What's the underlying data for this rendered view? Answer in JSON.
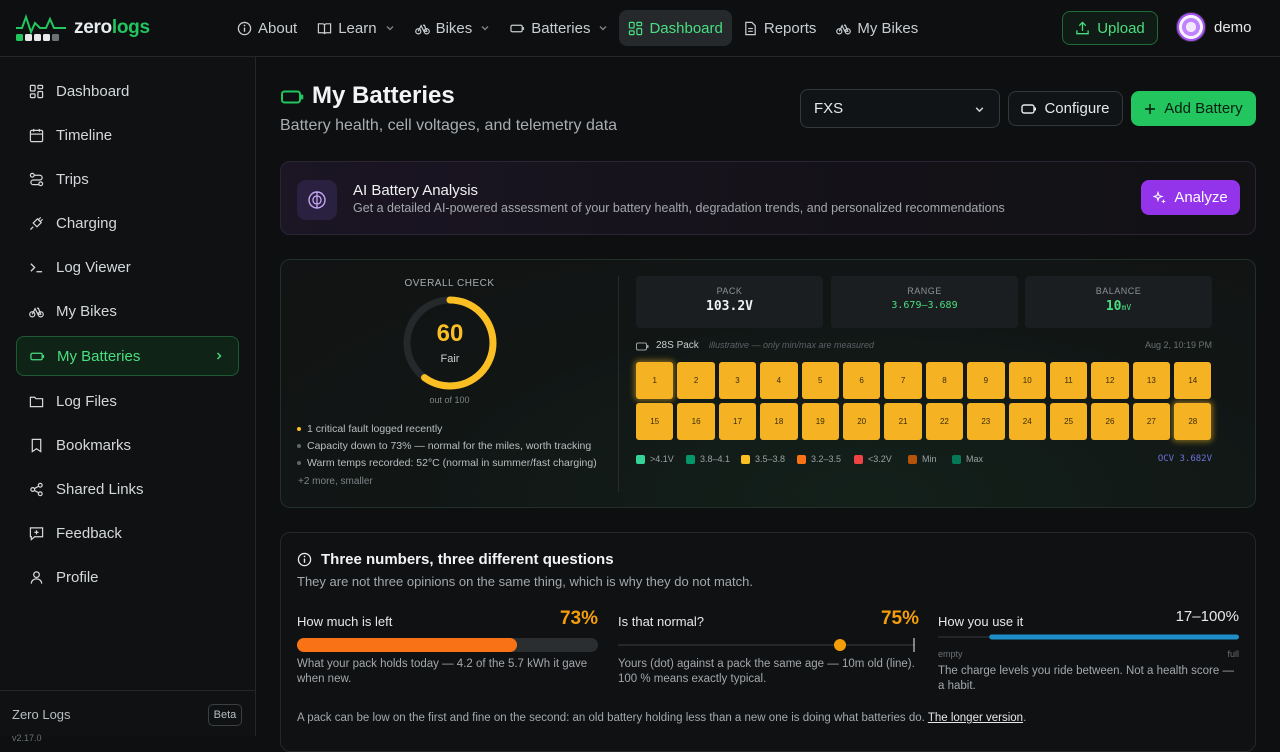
{
  "app": {
    "brand_left": "zero",
    "brand_right": "logs"
  },
  "nav": {
    "items": [
      {
        "label": "About"
      },
      {
        "label": "Learn"
      },
      {
        "label": "Bikes"
      },
      {
        "label": "Batteries"
      },
      {
        "label": "Dashboard"
      },
      {
        "label": "Reports"
      },
      {
        "label": "My Bikes"
      }
    ],
    "upload": "Upload",
    "user": "demo"
  },
  "sidebar": {
    "items": [
      {
        "label": "Dashboard"
      },
      {
        "label": "Timeline"
      },
      {
        "label": "Trips"
      },
      {
        "label": "Charging"
      },
      {
        "label": "Log Viewer"
      },
      {
        "label": "My Bikes"
      },
      {
        "label": "My Batteries"
      },
      {
        "label": "Log Files"
      },
      {
        "label": "Bookmarks"
      },
      {
        "label": "Shared Links"
      },
      {
        "label": "Feedback"
      },
      {
        "label": "Profile"
      }
    ],
    "footer_name": "Zero Logs",
    "footer_badge": "Beta",
    "footer_version": "v2.17.0"
  },
  "header": {
    "title": "My Batteries",
    "subtitle": "Battery health, cell voltages, and telemetry data",
    "battery_select": "FXS",
    "configure": "Configure",
    "add_battery": "Add Battery"
  },
  "ai": {
    "title": "AI Battery Analysis",
    "description": "Get a detailed AI-powered assessment of your battery health, degradation trends, and personalized recommendations",
    "button": "Analyze"
  },
  "health": {
    "label": "OVERALL CHECK",
    "score": "60",
    "score_value": 60,
    "rating": "Fair",
    "out_of": "out of 100",
    "notes": [
      {
        "text": "1 critical fault logged recently",
        "level": "warn"
      },
      {
        "text": "Capacity down to 73% — normal for the miles, worth tracking",
        "level": "info"
      },
      {
        "text": "Warm temps recorded: 52°C (normal in summer/fast charging)",
        "level": "info"
      }
    ],
    "more": "+2 more, smaller"
  },
  "pack": {
    "stats": [
      {
        "key": "PACK",
        "value": "103.2V"
      },
      {
        "key": "RANGE",
        "value": "3.679–3.689"
      },
      {
        "key": "BALANCE",
        "value": "10",
        "unit": "mV"
      }
    ],
    "label": "28S Pack",
    "note": "illustrative — only min/max are measured",
    "date": "Aug 2, 10:19 PM",
    "cells": [
      "1",
      "2",
      "3",
      "4",
      "5",
      "6",
      "7",
      "8",
      "9",
      "10",
      "11",
      "12",
      "13",
      "14",
      "15",
      "16",
      "17",
      "18",
      "19",
      "20",
      "21",
      "22",
      "23",
      "24",
      "25",
      "26",
      "27",
      "28"
    ],
    "highlight_cells": [
      "1",
      "28"
    ],
    "legend": [
      {
        "label": ">4.1V",
        "color": "#34d399"
      },
      {
        "label": "3.8–4.1",
        "color": "#059669"
      },
      {
        "label": "3.5–3.8",
        "color": "#fbbf24"
      },
      {
        "label": "3.2–3.5",
        "color": "#f97316"
      },
      {
        "label": "<3.2V",
        "color": "#ef4444"
      },
      {
        "label": "Min",
        "color": "#b45309"
      },
      {
        "label": "Max",
        "color": "#047857"
      }
    ],
    "ocv": "OCV 3.682V"
  },
  "questions": {
    "title": "Three numbers, three different questions",
    "subtitle": "They are not three opinions on the same thing, which is why they do not match.",
    "cols": [
      {
        "heading": "How much is left",
        "value": "73%",
        "fill": 0.73,
        "text": "What your pack holds today — 4.2 of the 5.7 kWh it gave when new."
      },
      {
        "heading": "Is that normal?",
        "value": "75%",
        "dot": 0.75,
        "text": "Yours (dot) against a pack the same age — 10m old (line). 100 % means exactly typical."
      },
      {
        "heading": "How you use it",
        "value": "17–100%",
        "range": [
          0.17,
          1.0
        ],
        "empty": "empty",
        "full": "full",
        "text": "The charge levels you ride between. Not a health score — a habit."
      }
    ],
    "footer": "A pack can be low on the first and fine on the second: an old battery holding less than a new one is doing what batteries do.",
    "footer_link": "The longer version"
  },
  "colors": {
    "accent": "#22c55e",
    "ai": "#9333ea",
    "cell": "#f5b324",
    "warn": "#f59e0b"
  }
}
